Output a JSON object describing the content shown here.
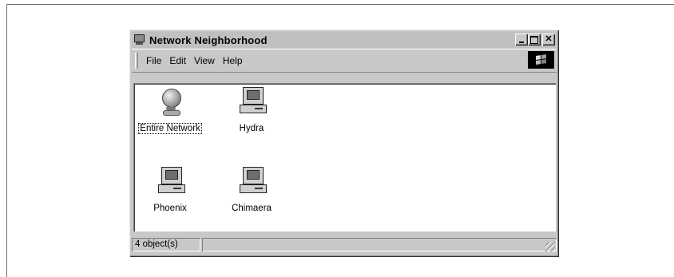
{
  "window": {
    "title": "Network Neighborhood"
  },
  "menu": {
    "items": [
      {
        "label": "File"
      },
      {
        "label": "Edit"
      },
      {
        "label": "View"
      },
      {
        "label": "Help"
      }
    ]
  },
  "content": {
    "items": [
      {
        "label": "Entire Network",
        "icon": "globe-icon",
        "selected": true
      },
      {
        "label": "Hydra",
        "icon": "computer-icon",
        "selected": false
      },
      {
        "label": "Phoenix",
        "icon": "computer-icon",
        "selected": false
      },
      {
        "label": "Chimaera",
        "icon": "computer-icon",
        "selected": false
      }
    ]
  },
  "status": {
    "objects": "4 object(s)"
  }
}
